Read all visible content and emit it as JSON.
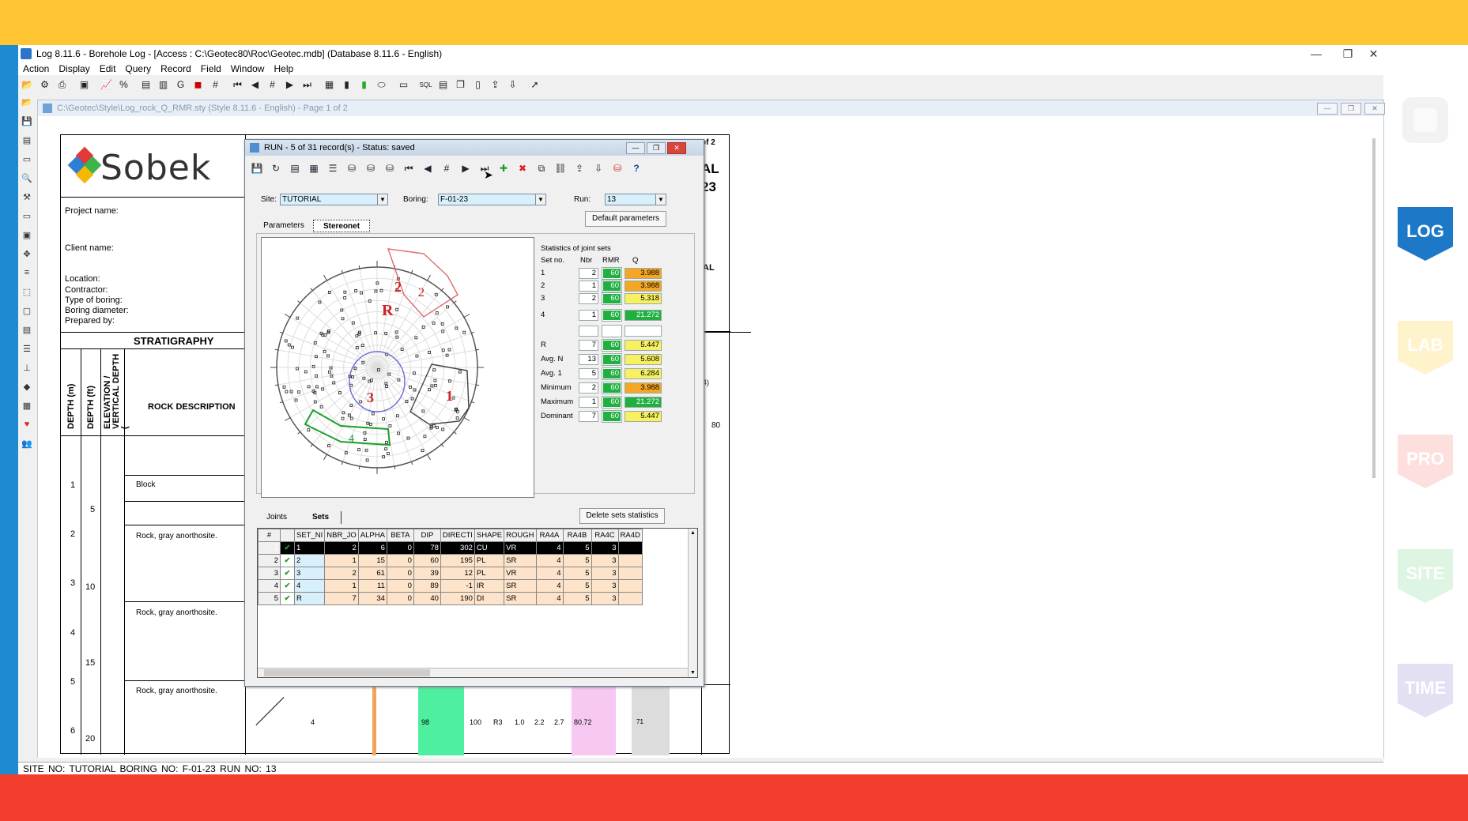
{
  "window": {
    "title": "Log 8.11.6 - Borehole Log - [Access : C:\\Geotec80\\Roc\\Geotec.mdb] (Database 8.11.6 - English)",
    "minimize": "—",
    "restore": "❐",
    "close": "✕"
  },
  "menu": [
    "Action",
    "Display",
    "Edit",
    "Query",
    "Record",
    "Field",
    "Window",
    "Help"
  ],
  "child": {
    "title": "C:\\Geotec\\Style\\Log_rock_Q_RMR.sty (Style 8.11.6 - English) - Page 1 of 2"
  },
  "log": {
    "logo_text": "Sobek",
    "project_label": "Project name:",
    "client_label": "Client name:",
    "location_label": "Location:",
    "contractor_label": "Contractor:",
    "type_label": "Type of boring:",
    "diameter_label": "Boring diameter:",
    "prepared_label": "Prepared by:",
    "stratigraphy": "STRATIGRAPHY",
    "depth_m": "DEPTH (m)",
    "depth_ft": "DEPTH (ft)",
    "elevation": "ELEVATION / VERTICAL DEPTH (",
    "rock_description": "ROCK DESCRIPTION",
    "page_of": "of 2",
    "header_al": "AL",
    "header_23": "23",
    "header_al2": "AL",
    "scale_80": "80",
    "paren": "4)",
    "descriptions": [
      "Block",
      "Rock, gray anorthosite.",
      "Rock, gray anorthosite.",
      "Rock, gray anorthosite."
    ],
    "depth_m_ticks": [
      "1",
      "2",
      "3",
      "4",
      "5",
      "6"
    ],
    "depth_ft_ticks": [
      "5",
      "10",
      "15",
      "20"
    ],
    "bottom_row": [
      "4",
      "98",
      "100",
      "R3",
      "1.0",
      "2.2",
      "2.7",
      "80.72",
      "71"
    ]
  },
  "dialog": {
    "title": "RUN - 5 of 31 record(s) - Status: saved",
    "site_label": "Site:",
    "site_value": "TUTORIAL",
    "boring_label": "Boring:",
    "boring_value": "F-01-23",
    "run_label": "Run:",
    "run_value": "13",
    "tab_parameters": "Parameters",
    "tab_stereonet": "Stereonet",
    "default_params": "Default parameters",
    "stats_title": "Statistics of joint sets",
    "col_setno": "Set no.",
    "col_nbr": "Nbr",
    "col_rmr": "RMR",
    "col_q": "Q",
    "stats": [
      {
        "set": "1",
        "nbr": "2",
        "rmr": "60",
        "q": "3.988",
        "qcolor": "#f5a623"
      },
      {
        "set": "2",
        "nbr": "1",
        "rmr": "60",
        "q": "3.988",
        "qcolor": "#f5a623"
      },
      {
        "set": "3",
        "nbr": "2",
        "rmr": "60",
        "q": "5.318",
        "qcolor": "#f7f060"
      },
      {
        "set": "4",
        "nbr": "1",
        "rmr": "60",
        "q": "21.272",
        "qcolor": "#1fb040"
      },
      {
        "set": "",
        "nbr": "",
        "rmr": "",
        "q": "",
        "qcolor": "#ffffff"
      },
      {
        "set": "R",
        "nbr": "7",
        "rmr": "60",
        "q": "5.447",
        "qcolor": "#f7f060"
      },
      {
        "set": "Avg. N",
        "nbr": "13",
        "rmr": "60",
        "q": "5.608",
        "qcolor": "#f7f060"
      },
      {
        "set": "Avg. 1",
        "nbr": "5",
        "rmr": "60",
        "q": "6.284",
        "qcolor": "#f7f060"
      },
      {
        "set": "Minimum",
        "nbr": "2",
        "rmr": "60",
        "q": "3.988",
        "qcolor": "#f5a623"
      },
      {
        "set": "Maximum",
        "nbr": "1",
        "rmr": "60",
        "q": "21.272",
        "qcolor": "#1fb040"
      },
      {
        "set": "Dominant",
        "nbr": "7",
        "rmr": "60",
        "q": "5.447",
        "qcolor": "#f7f060"
      }
    ],
    "tab_joints": "Joints",
    "tab_sets": "Sets",
    "delete_stats": "Delete sets statistics",
    "stereonet_labels": [
      "2",
      "2",
      "R",
      "3",
      "1",
      "4"
    ],
    "grid_headers": [
      "#",
      "",
      "SET_NI",
      "NBR_JO",
      "ALPHA",
      "BETA",
      "DIP",
      "DIRECTI",
      "SHAPE",
      "ROUGH",
      "RA4A",
      "RA4B",
      "RA4C",
      "RA4D"
    ],
    "grid_rows": [
      [
        "1",
        "1",
        "2",
        "6",
        "0",
        "78",
        "302",
        "CU",
        "VR",
        "4",
        "5",
        "3"
      ],
      [
        "2",
        "2",
        "1",
        "15",
        "0",
        "60",
        "195",
        "PL",
        "SR",
        "4",
        "5",
        "3"
      ],
      [
        "3",
        "3",
        "2",
        "61",
        "0",
        "39",
        "12",
        "PL",
        "VR",
        "4",
        "5",
        "3"
      ],
      [
        "4",
        "4",
        "1",
        "11",
        "0",
        "89",
        "-1",
        "IR",
        "SR",
        "4",
        "5",
        "3"
      ],
      [
        "5",
        "R",
        "7",
        "34",
        "0",
        "40",
        "190",
        "DI",
        "SR",
        "4",
        "5",
        "3"
      ]
    ]
  },
  "status": "SITE  NO: TUTORIAL    BORING  NO: F-01-23    RUN  NO: 13",
  "right_tabs": [
    {
      "label": "LOG",
      "color": "#1e78c8"
    },
    {
      "label": "LAB",
      "color": "#fff3cc"
    },
    {
      "label": "PRO",
      "color": "#fde0de"
    },
    {
      "label": "SITE",
      "color": "#ddf5e2"
    },
    {
      "label": "TIME",
      "color": "#e3e0f4"
    }
  ]
}
